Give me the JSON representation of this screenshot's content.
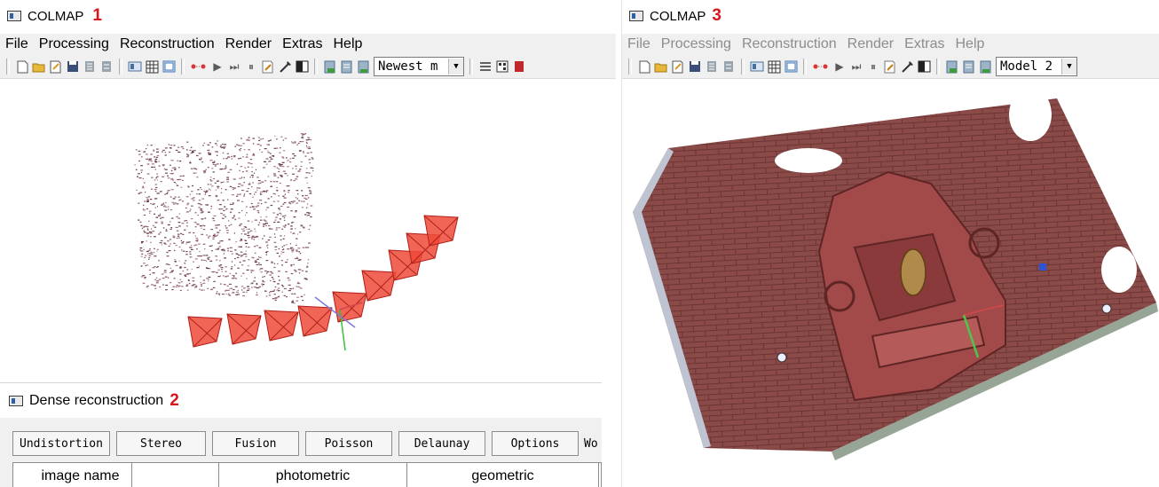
{
  "window1": {
    "title": "COLMAP",
    "step": "1",
    "menu": [
      "File",
      "Processing",
      "Reconstruction",
      "Render",
      "Extras",
      "Help"
    ],
    "combo_value": "Newest m"
  },
  "dense": {
    "title": "Dense reconstruction",
    "step": "2",
    "buttons": [
      "Undistortion",
      "Stereo",
      "Fusion",
      "Poisson",
      "Delaunay",
      "Options"
    ],
    "truncated_label": "Wo",
    "columns": [
      "image name",
      "",
      "photometric",
      "geometric"
    ]
  },
  "window3": {
    "title": "COLMAP",
    "step": "3",
    "menu": [
      "File",
      "Processing",
      "Reconstruction",
      "Render",
      "Extras",
      "Help"
    ],
    "combo_value": "Model 2"
  },
  "colors": {
    "step_label": "#d8141c",
    "camera_frustum": "#ee4a3a",
    "wall": "#8a4a48",
    "menu_disabled": "#8c8c8c"
  }
}
